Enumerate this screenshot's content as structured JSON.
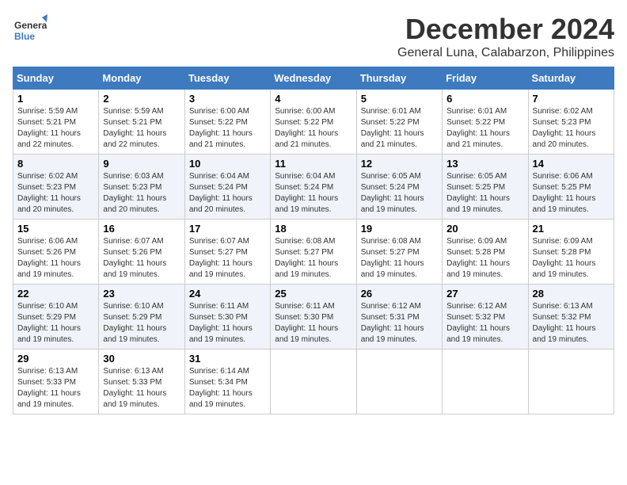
{
  "header": {
    "logo_line1": "General",
    "logo_line2": "Blue",
    "month": "December 2024",
    "location": "General Luna, Calabarzon, Philippines"
  },
  "weekdays": [
    "Sunday",
    "Monday",
    "Tuesday",
    "Wednesday",
    "Thursday",
    "Friday",
    "Saturday"
  ],
  "weeks": [
    [
      {
        "day": "1",
        "info": "Sunrise: 5:59 AM\nSunset: 5:21 PM\nDaylight: 11 hours\nand 22 minutes."
      },
      {
        "day": "2",
        "info": "Sunrise: 5:59 AM\nSunset: 5:21 PM\nDaylight: 11 hours\nand 22 minutes."
      },
      {
        "day": "3",
        "info": "Sunrise: 6:00 AM\nSunset: 5:22 PM\nDaylight: 11 hours\nand 21 minutes."
      },
      {
        "day": "4",
        "info": "Sunrise: 6:00 AM\nSunset: 5:22 PM\nDaylight: 11 hours\nand 21 minutes."
      },
      {
        "day": "5",
        "info": "Sunrise: 6:01 AM\nSunset: 5:22 PM\nDaylight: 11 hours\nand 21 minutes."
      },
      {
        "day": "6",
        "info": "Sunrise: 6:01 AM\nSunset: 5:22 PM\nDaylight: 11 hours\nand 21 minutes."
      },
      {
        "day": "7",
        "info": "Sunrise: 6:02 AM\nSunset: 5:23 PM\nDaylight: 11 hours\nand 20 minutes."
      }
    ],
    [
      {
        "day": "8",
        "info": "Sunrise: 6:02 AM\nSunset: 5:23 PM\nDaylight: 11 hours\nand 20 minutes."
      },
      {
        "day": "9",
        "info": "Sunrise: 6:03 AM\nSunset: 5:23 PM\nDaylight: 11 hours\nand 20 minutes."
      },
      {
        "day": "10",
        "info": "Sunrise: 6:04 AM\nSunset: 5:24 PM\nDaylight: 11 hours\nand 20 minutes."
      },
      {
        "day": "11",
        "info": "Sunrise: 6:04 AM\nSunset: 5:24 PM\nDaylight: 11 hours\nand 19 minutes."
      },
      {
        "day": "12",
        "info": "Sunrise: 6:05 AM\nSunset: 5:24 PM\nDaylight: 11 hours\nand 19 minutes."
      },
      {
        "day": "13",
        "info": "Sunrise: 6:05 AM\nSunset: 5:25 PM\nDaylight: 11 hours\nand 19 minutes."
      },
      {
        "day": "14",
        "info": "Sunrise: 6:06 AM\nSunset: 5:25 PM\nDaylight: 11 hours\nand 19 minutes."
      }
    ],
    [
      {
        "day": "15",
        "info": "Sunrise: 6:06 AM\nSunset: 5:26 PM\nDaylight: 11 hours\nand 19 minutes."
      },
      {
        "day": "16",
        "info": "Sunrise: 6:07 AM\nSunset: 5:26 PM\nDaylight: 11 hours\nand 19 minutes."
      },
      {
        "day": "17",
        "info": "Sunrise: 6:07 AM\nSunset: 5:27 PM\nDaylight: 11 hours\nand 19 minutes."
      },
      {
        "day": "18",
        "info": "Sunrise: 6:08 AM\nSunset: 5:27 PM\nDaylight: 11 hours\nand 19 minutes."
      },
      {
        "day": "19",
        "info": "Sunrise: 6:08 AM\nSunset: 5:27 PM\nDaylight: 11 hours\nand 19 minutes."
      },
      {
        "day": "20",
        "info": "Sunrise: 6:09 AM\nSunset: 5:28 PM\nDaylight: 11 hours\nand 19 minutes."
      },
      {
        "day": "21",
        "info": "Sunrise: 6:09 AM\nSunset: 5:28 PM\nDaylight: 11 hours\nand 19 minutes."
      }
    ],
    [
      {
        "day": "22",
        "info": "Sunrise: 6:10 AM\nSunset: 5:29 PM\nDaylight: 11 hours\nand 19 minutes."
      },
      {
        "day": "23",
        "info": "Sunrise: 6:10 AM\nSunset: 5:29 PM\nDaylight: 11 hours\nand 19 minutes."
      },
      {
        "day": "24",
        "info": "Sunrise: 6:11 AM\nSunset: 5:30 PM\nDaylight: 11 hours\nand 19 minutes."
      },
      {
        "day": "25",
        "info": "Sunrise: 6:11 AM\nSunset: 5:30 PM\nDaylight: 11 hours\nand 19 minutes."
      },
      {
        "day": "26",
        "info": "Sunrise: 6:12 AM\nSunset: 5:31 PM\nDaylight: 11 hours\nand 19 minutes."
      },
      {
        "day": "27",
        "info": "Sunrise: 6:12 AM\nSunset: 5:32 PM\nDaylight: 11 hours\nand 19 minutes."
      },
      {
        "day": "28",
        "info": "Sunrise: 6:13 AM\nSunset: 5:32 PM\nDaylight: 11 hours\nand 19 minutes."
      }
    ],
    [
      {
        "day": "29",
        "info": "Sunrise: 6:13 AM\nSunset: 5:33 PM\nDaylight: 11 hours\nand 19 minutes."
      },
      {
        "day": "30",
        "info": "Sunrise: 6:13 AM\nSunset: 5:33 PM\nDaylight: 11 hours\nand 19 minutes."
      },
      {
        "day": "31",
        "info": "Sunrise: 6:14 AM\nSunset: 5:34 PM\nDaylight: 11 hours\nand 19 minutes."
      },
      null,
      null,
      null,
      null
    ]
  ]
}
